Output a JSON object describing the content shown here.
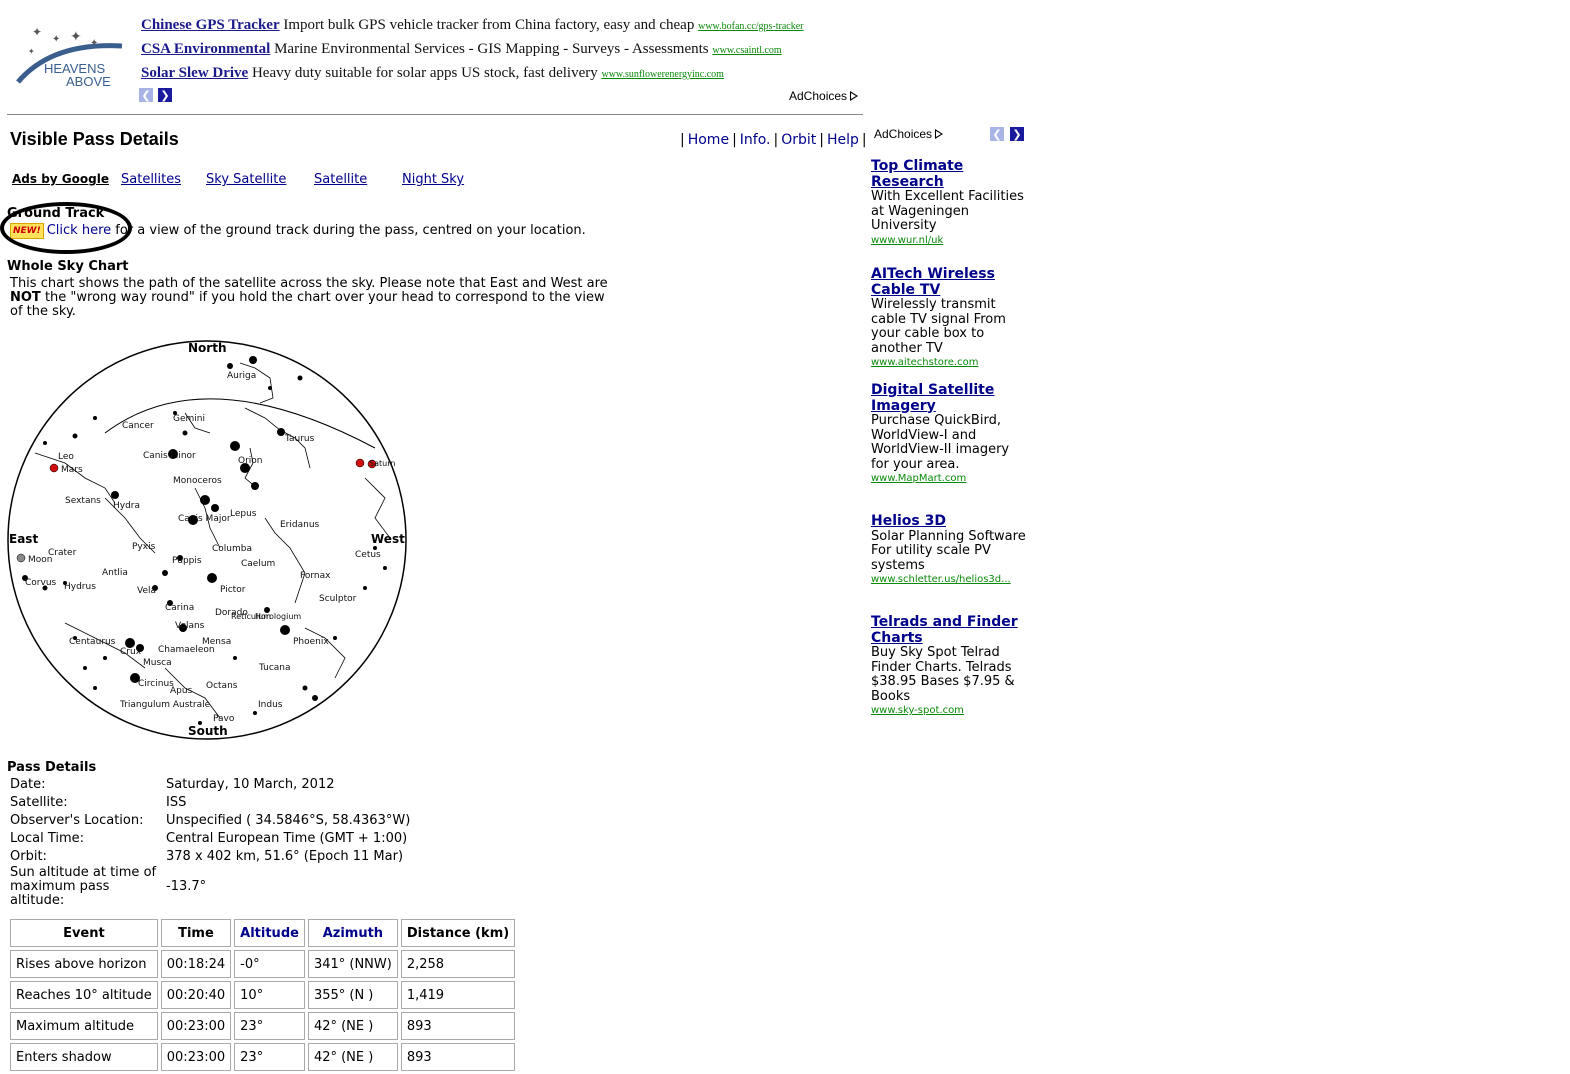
{
  "logo": {
    "line1": "HEAVENS",
    "line2": "ABOVE"
  },
  "top_ads": [
    {
      "title": "Chinese GPS Tracker",
      "desc": "Import bulk GPS vehicle tracker from China factory, easy and cheap",
      "url": "www.bofan.cc/gps-tracker"
    },
    {
      "title": "CSA Environmental",
      "desc": "Marine Environmental Services - GIS Mapping - Surveys - Assessments",
      "url": "www.csaintl.com"
    },
    {
      "title": "Solar Slew Drive",
      "desc": "Heavy duty suitable for solar apps US stock, fast delivery",
      "url": "www.sunflowerenergyinc.com"
    }
  ],
  "adchoices_label": "AdChoices",
  "page_title": "Visible Pass Details",
  "top_links": [
    "Home",
    "Info.",
    "Orbit",
    "Help"
  ],
  "ads_nav": {
    "label": "Ads by Google",
    "links": [
      "Satellites",
      "Sky Satellite",
      "Satellite",
      "Night Sky"
    ]
  },
  "ground_track": {
    "heading": "Ground Track",
    "badge": "NEW!",
    "link": "Click here",
    "text": "for a view of the ground track during the pass, centred on your location."
  },
  "sky_chart": {
    "heading": "Whole Sky Chart",
    "desc_1": "This chart shows the path of the satellite across the sky. Please note that East and West are",
    "desc_bold": "NOT",
    "desc_2": "the \"wrong way round\" if you hold the chart over your head to correspond to the view of the sky.",
    "directions": {
      "north": "North",
      "south": "South",
      "east": "East",
      "west": "West"
    },
    "labels": [
      "Auriga",
      "Cancer",
      "Gemini",
      "Taurus",
      "Canis Minor",
      "Orion",
      "Leo",
      "Mars",
      "Monoceros",
      "Sextans",
      "Hydra",
      "Lepus",
      "Canis Major",
      "Eridanus",
      "Pyxis",
      "Columba",
      "Puppis",
      "Caelum",
      "Crater",
      "Moon",
      "Antlia",
      "Vela",
      "Fornax",
      "Corvus",
      "Hydrus",
      "Pictor",
      "Cetus",
      "Sculptor",
      "Carina",
      "Dorado",
      "Reticulum",
      "Horologium",
      "Volans",
      "Mensa",
      "Phoenix",
      "Centaurus",
      "Crux",
      "Chamaeleon",
      "Musca",
      "Tucana",
      "Circinus",
      "Apus",
      "Octans",
      "Triangulum Australe",
      "Indus",
      "Pavo",
      "Saturn"
    ]
  },
  "pass_details": {
    "heading": "Pass Details",
    "rows": [
      {
        "label": "Date:",
        "value": "Saturday, 10 March, 2012"
      },
      {
        "label": "Satellite:",
        "value": "ISS"
      },
      {
        "label": "Observer's Location:",
        "value": "Unspecified ( 34.5846°S, 58.4363°W)"
      },
      {
        "label": "Local Time:",
        "value": "Central European Time (GMT + 1:00)"
      },
      {
        "label": "Orbit:",
        "value": "378 x 402 km, 51.6° (Epoch 11 Mar)"
      },
      {
        "label": "Sun altitude at time of maximum pass altitude:",
        "value": "-13.7°"
      }
    ]
  },
  "events_table": {
    "headers": [
      "Event",
      "Time",
      "Altitude",
      "Azimuth",
      "Distance (km)"
    ],
    "rows": [
      [
        "Rises above horizon",
        "00:18:24",
        "-0°",
        "341° (NNW)",
        "2,258"
      ],
      [
        "Reaches 10° altitude",
        "00:20:40",
        "10°",
        "355° (N )",
        "1,419"
      ],
      [
        "Maximum altitude",
        "00:23:00",
        "23°",
        "42° (NE )",
        "893"
      ],
      [
        "Enters shadow",
        "00:23:00",
        "23°",
        "42° (NE )",
        "893"
      ]
    ]
  },
  "side_ads": [
    {
      "title": "Top Climate Research",
      "desc": "With Excellent Facilities at Wageningen University",
      "url": "www.wur.nl/uk"
    },
    {
      "title": "AITech Wireless Cable TV",
      "desc": "Wirelessly transmit cable TV signal From your cable box to another TV",
      "url": "www.aitechstore.com"
    },
    {
      "title": "Digital Satellite Imagery",
      "desc": "Purchase QuickBird, WorldView-I and WorldView-II imagery for your area.",
      "url": "www.MapMart.com"
    },
    {
      "title": "Helios 3D",
      "desc": "Solar Planning Software For utility scale PV systems",
      "url": "www.schletter.us/helios3d..."
    },
    {
      "title": "Telrads and Finder Charts",
      "desc": "Buy Sky Spot Telrad Finder Charts. Telrads $38.95 Bases $7.95 & Books",
      "url": "www.sky-spot.com"
    }
  ]
}
